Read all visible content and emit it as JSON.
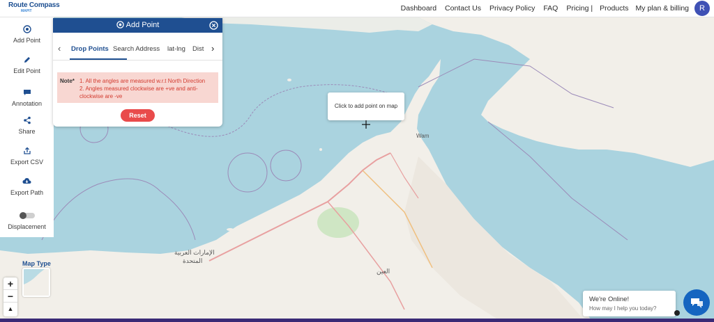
{
  "brand": {
    "title": "Route Compass",
    "subtitle": "MAPIT"
  },
  "nav": {
    "items": [
      "Dashboard",
      "Contact Us",
      "Privacy Policy",
      "FAQ",
      "Pricing |",
      "Products",
      "My plan & billing"
    ],
    "avatar_letter": "R"
  },
  "sidebar": {
    "items": [
      {
        "label": "Add Point",
        "icon": "target-icon"
      },
      {
        "label": "Edit Point",
        "icon": "pencil-icon"
      },
      {
        "label": "Annotation",
        "icon": "comment-icon"
      },
      {
        "label": "Share",
        "icon": "share-icon"
      },
      {
        "label": "Export CSV",
        "icon": "upload-icon"
      },
      {
        "label": "Export Path",
        "icon": "cloud-download-icon"
      },
      {
        "label": "Displacement",
        "icon": "toggle-icon"
      }
    ]
  },
  "panel": {
    "title": "Add Point",
    "tabs": [
      "Drop Points",
      "Search Address",
      "lat-lng",
      "Dist"
    ],
    "active_tab": "Drop Points",
    "note_label": "Note*",
    "note_lines": [
      "1. All the angles are measured w.r.t North Direction",
      "2. Angles measured clockwise are +ve and anti-",
      "clockwise are -ve"
    ],
    "reset_label": "Reset"
  },
  "map": {
    "tooltip": "Click to add point on map",
    "map_type_label": "Map Type",
    "zoom_in": "+",
    "zoom_out": "−",
    "compass": "▲",
    "labels": [
      "Wam",
      "الإمارات العربية",
      "المتحدة",
      "العين"
    ]
  },
  "chat": {
    "title": "We're Online!",
    "subtitle": "How may I help you today?"
  },
  "colors": {
    "accent": "#1f4f91",
    "reset": "#e94b4b",
    "water": "#aad3df",
    "land": "#f2efe9",
    "avatar": "#3f51b5",
    "chat": "#1565c0"
  }
}
